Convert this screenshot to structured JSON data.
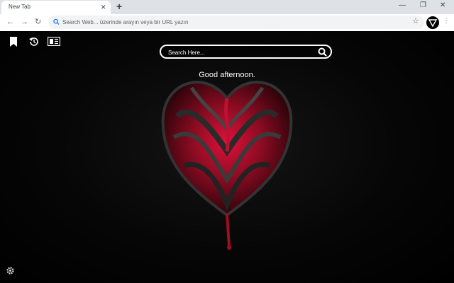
{
  "browser": {
    "tab_title": "New Tab",
    "tab_close": "✕",
    "new_tab": "+",
    "minimize": "—",
    "restore": "❐",
    "address_placeholder": "Search Web... üzerinde arayın veya bir URL yazın",
    "back": "←",
    "forward": "→",
    "reload": "↻",
    "bookmark_star": "☆",
    "menu": "⋮"
  },
  "page": {
    "search_placeholder": "Search Here...",
    "greeting": "Good afternoon.",
    "left_icons": [
      "bookmark-icon",
      "history-icon",
      "news-icon"
    ],
    "settings_icon": "gear-icon",
    "background": "dark red glass heart wallpaper"
  },
  "colors": {
    "accent": "#e0103a",
    "dark_red": "#6b0a1a",
    "toolbar": "#dee1e6"
  }
}
